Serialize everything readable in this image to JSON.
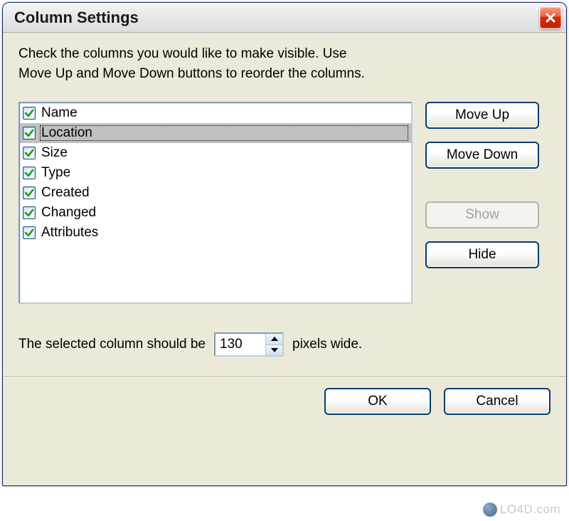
{
  "window": {
    "title": "Column Settings"
  },
  "instructions": {
    "line1": "Check the columns you would like to make visible. Use",
    "line2": "Move Up and Move Down buttons to reorder the columns."
  },
  "columns": [
    {
      "label": "Name",
      "checked": true,
      "selected": false
    },
    {
      "label": "Location",
      "checked": true,
      "selected": true
    },
    {
      "label": "Size",
      "checked": true,
      "selected": false
    },
    {
      "label": "Type",
      "checked": true,
      "selected": false
    },
    {
      "label": "Created",
      "checked": true,
      "selected": false
    },
    {
      "label": "Changed",
      "checked": true,
      "selected": false
    },
    {
      "label": "Attributes",
      "checked": true,
      "selected": false
    }
  ],
  "buttons": {
    "move_up": "Move Up",
    "move_down": "Move Down",
    "show": "Show",
    "hide": "Hide",
    "ok": "OK",
    "cancel": "Cancel"
  },
  "width_row": {
    "prefix": "The selected column should be",
    "value": "130",
    "suffix": "pixels wide."
  },
  "watermark": "LO4D.com"
}
